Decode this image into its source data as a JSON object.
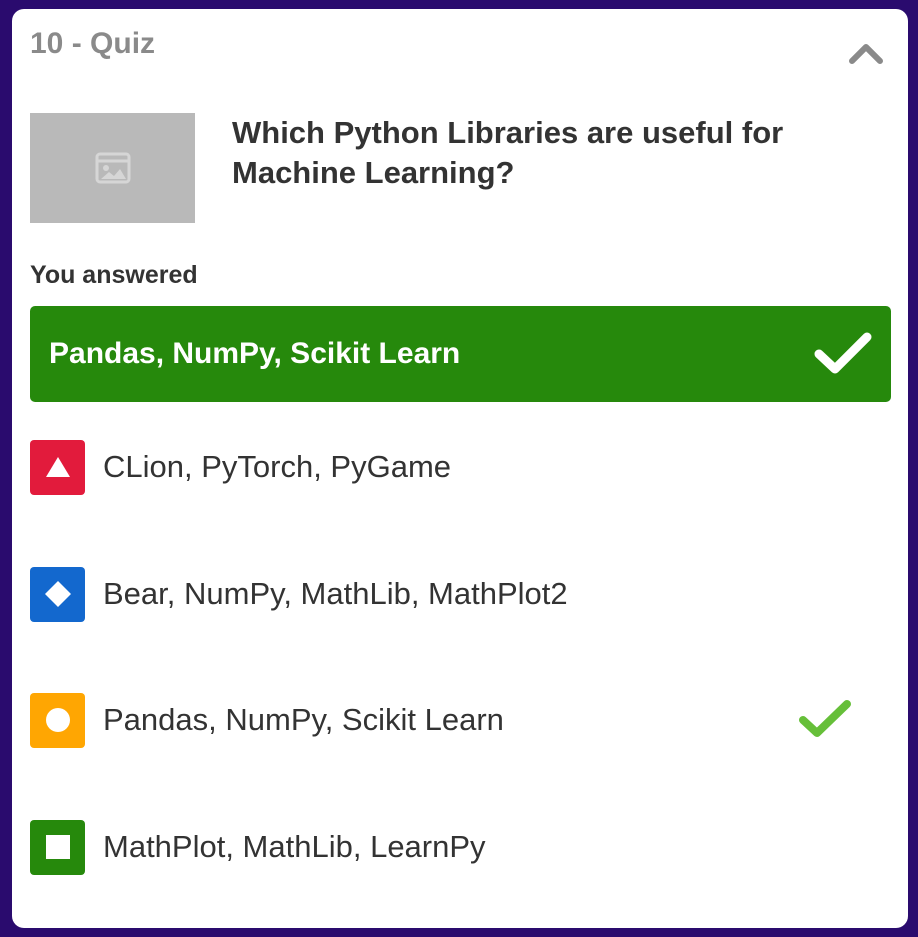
{
  "quiz": {
    "header_title": "10 - Quiz",
    "question": "Which Python Libraries are useful for Machine Learning?",
    "you_answered_label": "You answered",
    "selected_answer": "Pandas, NumPy, Scikit Learn",
    "options": [
      {
        "label": "CLion, PyTorch, PyGame",
        "shape": "triangle",
        "color": "#e21b3c",
        "correct": false
      },
      {
        "label": "Bear, NumPy, MathLib, MathPlot2",
        "shape": "diamond",
        "color": "#1368ce",
        "correct": false
      },
      {
        "label": "Pandas, NumPy, Scikit Learn",
        "shape": "circle",
        "color": "#ffa602",
        "correct": true
      },
      {
        "label": "MathPlot, MathLib, LearnPy",
        "shape": "square",
        "color": "#26890c",
        "correct": false
      }
    ]
  },
  "colors": {
    "background": "#2a0b6e",
    "card": "#ffffff",
    "correct_bar": "#26890c",
    "check_green": "#66bf39",
    "header_gray": "#8a8a8a",
    "text": "#333333"
  },
  "icons": {
    "collapse": "chevron-up-icon",
    "thumbnail": "image-placeholder-icon",
    "correct": "check-icon"
  }
}
